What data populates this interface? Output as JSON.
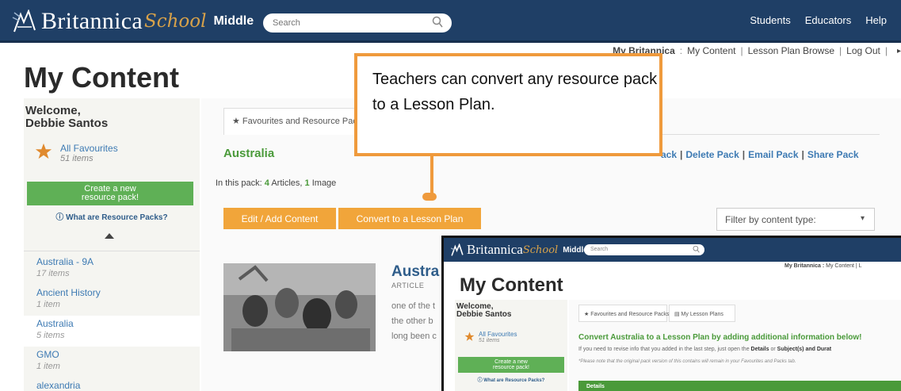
{
  "header": {
    "brand": "Britannica",
    "brand_school": "School",
    "level": "Middle",
    "search_placeholder": "Search",
    "nav": [
      "Students",
      "Educators",
      "Help"
    ]
  },
  "subnav": {
    "my_britannica": "My Britannica",
    "my_britannica_sep": ":",
    "my_content": "My Content",
    "lesson_plan_browse": "Lesson Plan Browse",
    "log_out": "Log Out",
    "more_arrow": "▸"
  },
  "page_title": "My Content",
  "sidebar": {
    "welcome_line1": "Welcome,",
    "welcome_line2": "Debbie Santos",
    "favourites_label": "All Favourites",
    "favourites_count": "51 items",
    "create_button_line1": "Create a new",
    "create_button_line2": "resource pack!",
    "what_link": "ⓘ What are Resource Packs?",
    "packs": [
      {
        "name": "Australia - 9A",
        "count": "17 items"
      },
      {
        "name": "Ancient History",
        "count": "1 item"
      },
      {
        "name": "Australia",
        "count": "5 items"
      },
      {
        "name": "GMO",
        "count": "1 item"
      },
      {
        "name": "alexandria",
        "count": ""
      }
    ]
  },
  "main": {
    "tab_label": "★ Favourites and Resource Packs",
    "pack_title": "Australia",
    "actions": [
      "ack",
      "Delete Pack",
      "Email Pack",
      "Share Pack"
    ],
    "in_pack_prefix": "In this pack:",
    "articles_count": "4",
    "articles_word": "Articles,",
    "images_count": "1",
    "images_word": "Image",
    "edit_button": "Edit / Add Content",
    "convert_button": "Convert to a Lesson Plan",
    "filter_label": "Filter by content type:",
    "article": {
      "title": "Austra",
      "type": "ARTICLE",
      "excerpt_lines": [
        "one of the t",
        "the other b",
        "long been c"
      ]
    }
  },
  "callout": {
    "text": "Teachers can convert any resource pack to a Lesson Plan."
  },
  "inset": {
    "brand": "Britannica",
    "brand_school": "School",
    "level": "Middle",
    "search_placeholder": "Search",
    "subnav_bold": "My Britannica :",
    "subnav_rest": "My Content | L",
    "title": "My Content",
    "welcome_line1": "Welcome,",
    "welcome_line2": "Debbie Santos",
    "favourites_label": "All Favourites",
    "favourites_count": "51 items",
    "create_line1": "Create a new",
    "create_line2": "resource pack!",
    "what_link": "ⓘ What are Resource Packs?",
    "tabs": [
      "★ Favourites and Resource Packs",
      "▤ My Lesson Plans"
    ],
    "heading": "Convert Australia to a Lesson Plan by adding additional information below!",
    "text_line_start": "If you need to revise info that you added in the last step, just open the",
    "text_details": "Details",
    "text_or": "or",
    "text_subjects": "Subject(s) and Durat",
    "note": "*Please note that the original pack version of this contains will remain in your Favourites and Packs tab.",
    "details_label": "Details"
  },
  "colors": {
    "header_bg": "#1f3f66",
    "accent_orange": "#f1a53a",
    "callout_border": "#ef9a3c",
    "green": "#5fb056",
    "link_blue": "#3d7ab3"
  }
}
